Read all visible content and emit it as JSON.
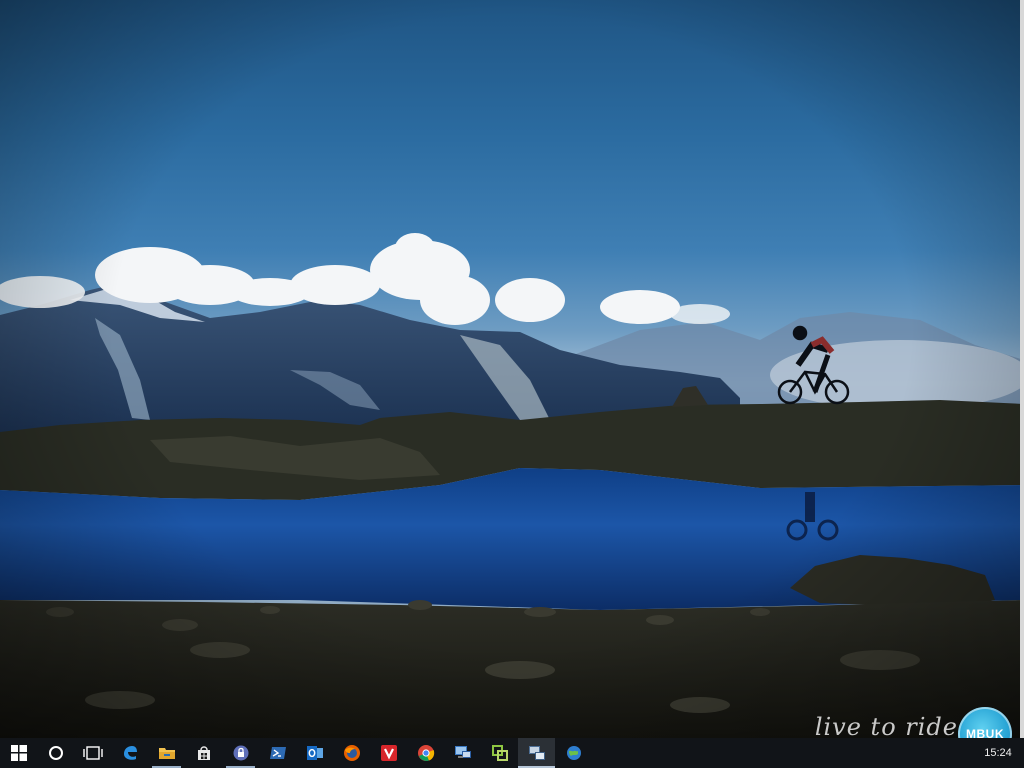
{
  "desktop": {
    "wallpaper_watermark": "live to ride",
    "watermark_badge": "MBUK"
  },
  "taskbar": {
    "start_icon": "windows-logo-icon",
    "search_icon": "cortana-circle-icon",
    "task_view_icon": "task-view-icon",
    "apps": [
      {
        "name": "edge-icon",
        "running": false,
        "active": false
      },
      {
        "name": "file-explorer-icon",
        "running": true,
        "active": false
      },
      {
        "name": "store-icon",
        "running": false,
        "active": false
      },
      {
        "name": "keepass-lock-icon",
        "running": true,
        "active": false
      },
      {
        "name": "powershell-icon",
        "running": false,
        "active": false
      },
      {
        "name": "outlook-icon",
        "running": false,
        "active": false
      },
      {
        "name": "firefox-icon",
        "running": false,
        "active": false
      },
      {
        "name": "vivaldi-icon",
        "running": false,
        "active": false
      },
      {
        "name": "chrome-icon",
        "running": false,
        "active": false
      },
      {
        "name": "remote-desktop-icon",
        "running": false,
        "active": false
      },
      {
        "name": "vmware-icon",
        "running": false,
        "active": false
      },
      {
        "name": "network-window-icon",
        "running": true,
        "active": true
      },
      {
        "name": "globe-app-icon",
        "running": false,
        "active": false
      }
    ],
    "clock": "15:24"
  }
}
